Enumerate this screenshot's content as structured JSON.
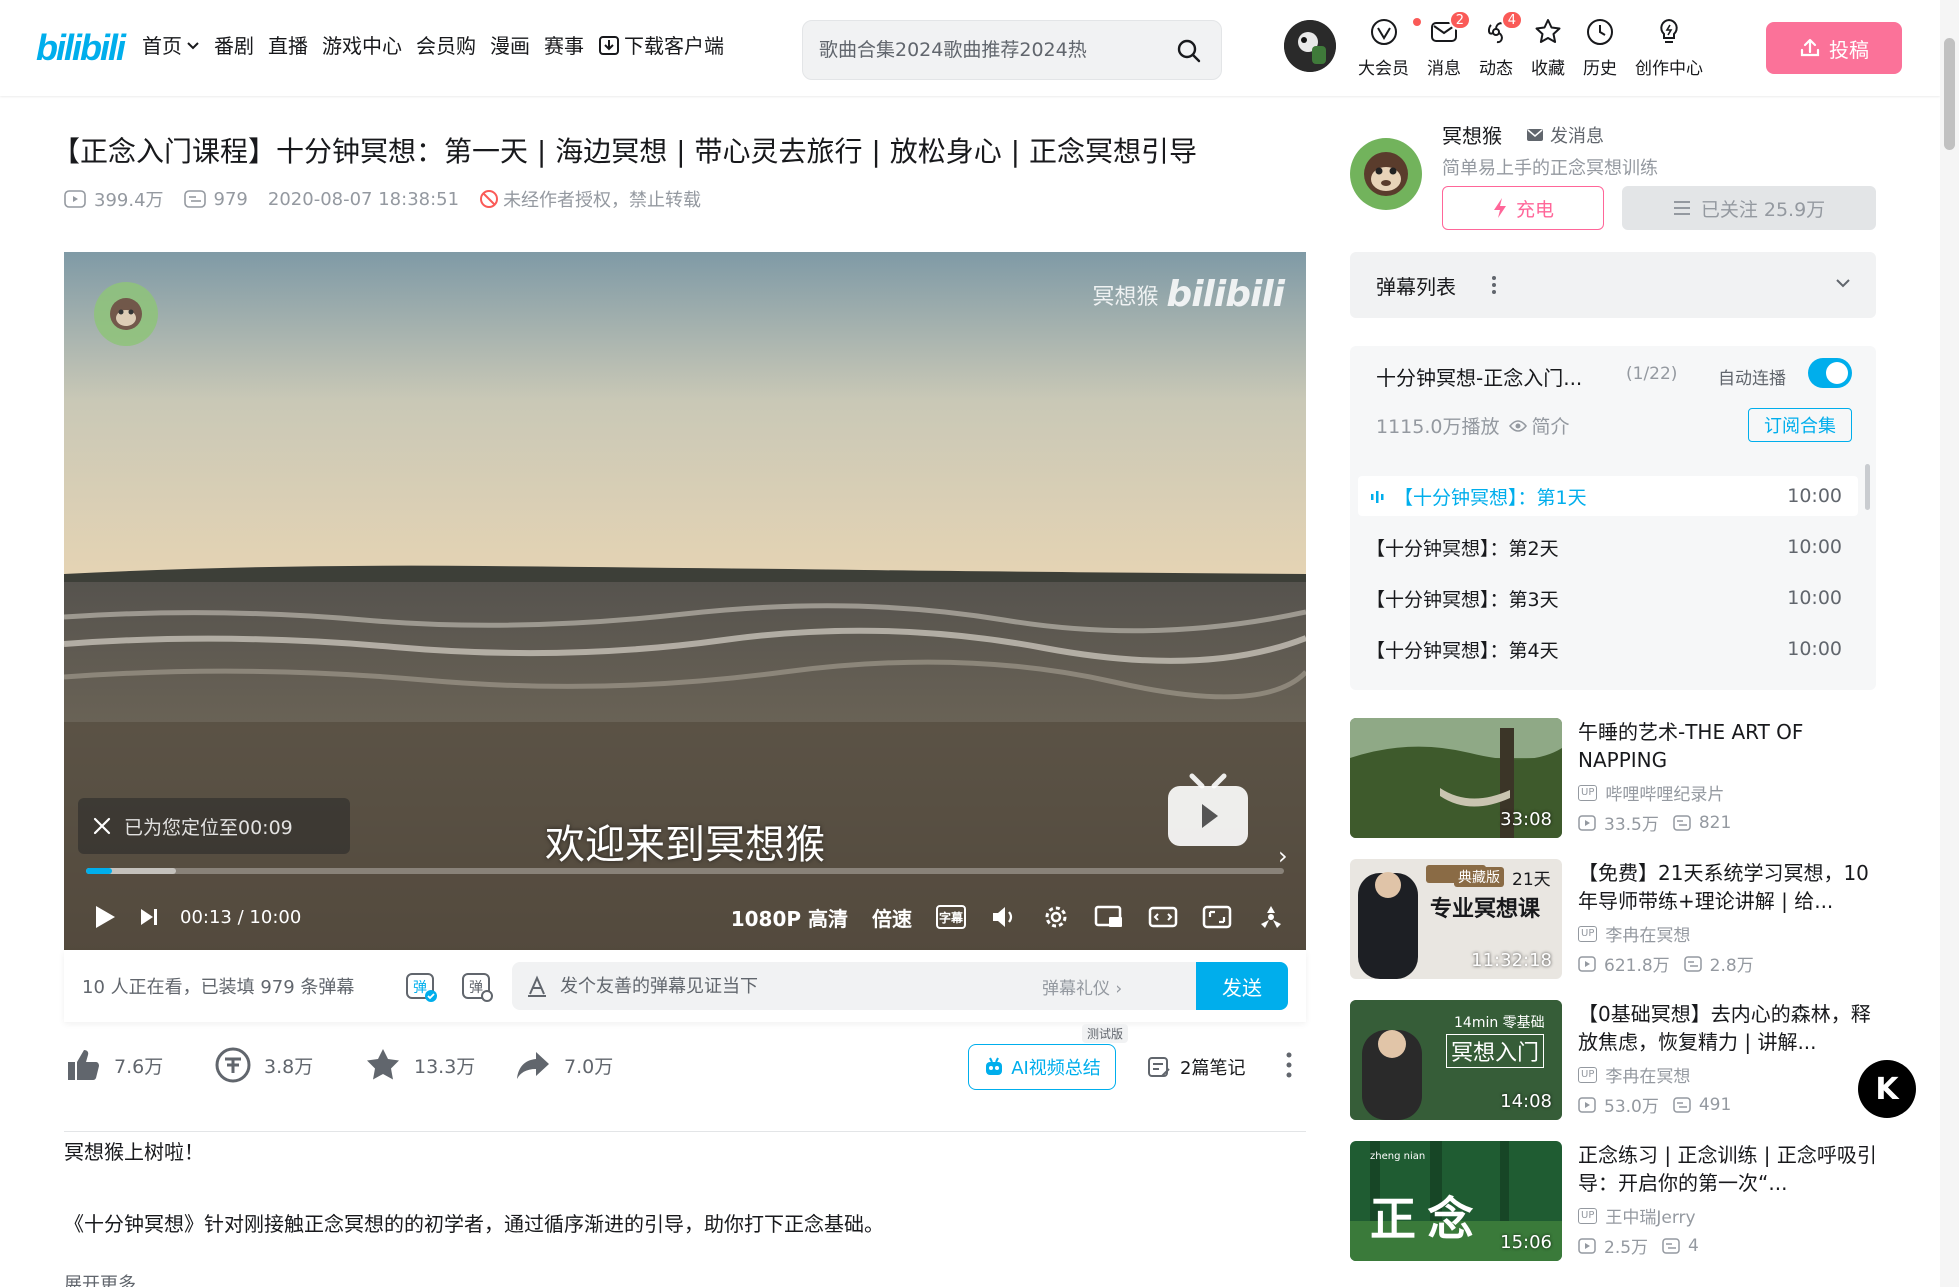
{
  "header": {
    "logo_text": "bilibili",
    "nav": [
      {
        "label": "首页",
        "dropdown": true
      },
      {
        "label": "番剧"
      },
      {
        "label": "直播"
      },
      {
        "label": "游戏中心"
      },
      {
        "label": "会员购"
      },
      {
        "label": "漫画"
      },
      {
        "label": "赛事"
      },
      {
        "label": "下载客户端",
        "icon": "download-icon"
      }
    ],
    "search_placeholder": "歌曲合集2024歌曲推荐2024热",
    "entries": [
      {
        "label": "大会员",
        "icon": "vip-icon",
        "dot": true
      },
      {
        "label": "消息",
        "icon": "message-icon",
        "badge": "2"
      },
      {
        "label": "动态",
        "icon": "dynamic-icon",
        "badge": "4"
      },
      {
        "label": "收藏",
        "icon": "star-icon"
      },
      {
        "label": "历史",
        "icon": "clock-icon"
      },
      {
        "label": "创作中心",
        "icon": "bulb-icon"
      }
    ],
    "upload_label": "投稿"
  },
  "video": {
    "title": "【正念入门课程】十分钟冥想：第一天 | 海边冥想 | 带心灵去旅行 | 放松身心 | 正念冥想引导",
    "views": "399.4万",
    "danmaku_count": "979",
    "pubdate": "2020-08-07 18:38:51",
    "copyright": "未经作者授权，禁止转载"
  },
  "player": {
    "watermark_name": "冥想猴",
    "watermark_logo": "bilibili",
    "subtitle": "欢迎来到冥想猴",
    "resume_toast": "已为您定位至00:09",
    "current_time": "00:13",
    "time_sep": "/",
    "duration": "10:00",
    "progress_fraction": 0.0217,
    "buffered_fraction": 0.075,
    "quality": "1080P 高清",
    "speed": "倍速",
    "subtitle_btn": "字幕"
  },
  "danmaku_bar": {
    "watching": "10 人正在看，已装填 979 条弹幕",
    "placeholder": "发个友善的弹幕见证当下",
    "etiquette": "弹幕礼仪 ›",
    "send": "发送"
  },
  "toolbar": {
    "like": "7.6万",
    "coin": "3.8万",
    "fav": "13.3万",
    "share": "7.0万",
    "ai_summary": "AI视频总结",
    "beta": "测试版",
    "notes": "2篇笔记"
  },
  "description": {
    "line1": "冥想猴上树啦！",
    "line2": "《十分钟冥想》针对刚接触正念冥想的的初学者，通过循序渐进的引导，助你打下正念基础。",
    "more": "展开更多"
  },
  "uploader": {
    "name": "冥想猴",
    "message": "发消息",
    "desc": "简单易上手的正念冥想训练",
    "charge": "充电",
    "follow": "已关注 25.9万"
  },
  "danmaku_list": {
    "title": "弹幕列表"
  },
  "collection": {
    "title": "十分钟冥想-正念入门...",
    "index": "(1/22)",
    "autoplay_label": "自动连播",
    "autoplay_on": true,
    "plays": "1115.0万播放",
    "intro": "简介",
    "subscribe": "订阅合集",
    "episodes": [
      {
        "title": "【十分钟冥想】：第1天",
        "duration": "10:00",
        "active": true
      },
      {
        "title": "【十分钟冥想】：第2天",
        "duration": "10:00"
      },
      {
        "title": "【十分钟冥想】：第3天",
        "duration": "10:00"
      },
      {
        "title": "【十分钟冥想】：第4天",
        "duration": "10:00"
      }
    ]
  },
  "recommendations": [
    {
      "title": "午睡的艺术-THE ART OF NAPPING",
      "author": "哔哩哔哩纪录片",
      "views": "33.5万",
      "danmaku": "821",
      "duration": "33:08",
      "thumb_text": ""
    },
    {
      "title": "【免费】21天系统学习冥想，10年导师带练+理论讲解 | 给...",
      "author": "李冉在冥想",
      "views": "621.8万",
      "danmaku": "2.8万",
      "duration": "11:32:18",
      "thumb_badge": "典藏版",
      "thumb_text_a": "21天",
      "thumb_text_b": "专业冥想课"
    },
    {
      "title": "【0基础冥想】去内心的森林，释放焦虑，恢复精力 | 讲解...",
      "author": "李冉在冥想",
      "views": "53.0万",
      "danmaku": "491",
      "duration": "14:08",
      "thumb_text_a": "14min 零基础",
      "thumb_text_b": "冥想入门"
    },
    {
      "title": "正念练习 | 正念训练 | 正念呼吸引导：开启你的第一次“...",
      "author": "王中瑞Jerry",
      "views": "2.5万",
      "danmaku": "4",
      "duration": "15:06",
      "thumb_text_a": "正 念",
      "thumb_text_b": "zheng nian"
    }
  ],
  "colors": {
    "brand_blue": "#00aeec",
    "brand_pink": "#fb7299",
    "badge_red": "#fa5a57"
  }
}
